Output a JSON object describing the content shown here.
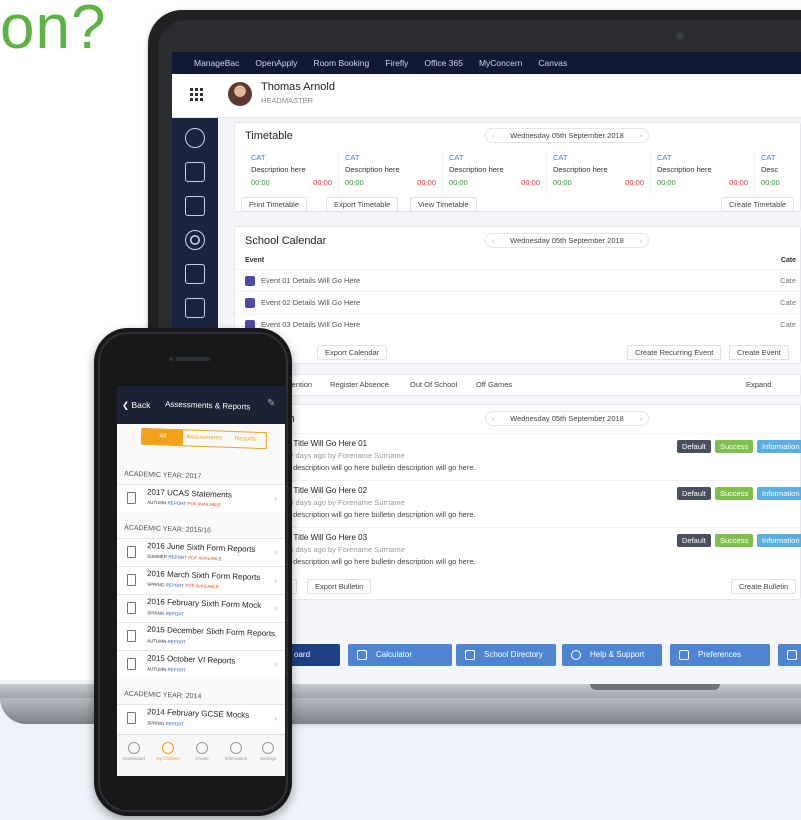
{
  "headline": "on?",
  "laptop": {
    "topnav": [
      "ManageBac",
      "OpenApply",
      "Room Booking",
      "Firefly",
      "Office 365",
      "MyConcern",
      "Canvas"
    ],
    "user": {
      "name": "Thomas Arnold",
      "role": "HEADMASTER"
    },
    "timetable": {
      "title": "Timetable",
      "date": "Wednesday 05th September 2018",
      "slots": [
        {
          "cat": "CAT",
          "desc": "Description here",
          "start": "00:00",
          "end": "00:00"
        },
        {
          "cat": "CAT",
          "desc": "Description here",
          "start": "00:00",
          "end": "00:00"
        },
        {
          "cat": "CAT",
          "desc": "Description here",
          "start": "00:00",
          "end": "00:00"
        },
        {
          "cat": "CAT",
          "desc": "Description here",
          "start": "00:00",
          "end": "00:00"
        },
        {
          "cat": "CAT",
          "desc": "Description here",
          "start": "00:00",
          "end": "00:00"
        },
        {
          "cat": "CAT",
          "desc": "Desc",
          "start": "00:00",
          "end": ""
        }
      ],
      "buttons": {
        "print": "Print Timetable",
        "export": "Export Timetable",
        "view": "View Timetable",
        "create": "Create Timetable"
      }
    },
    "calendar": {
      "title": "School Calendar",
      "date": "Wednesday 05th September 2018",
      "col_event": "Event",
      "col_cat": "Cate",
      "events": [
        {
          "text": "Event 01 Details Will Go Here",
          "cat": "Cate"
        },
        {
          "text": "Event 02 Details Will Go Here",
          "cat": "Cate"
        },
        {
          "text": "Event 03 Details Will Go Here",
          "cat": "Cate"
        }
      ],
      "buttons": {
        "view": "alendar",
        "export": "Export Calendar",
        "recurring": "Create Recurring Event",
        "create": "Create Event"
      }
    },
    "tabs": {
      "detention": "Detention",
      "absence": "Register Absence",
      "out": "Out Of School",
      "games": "Off Games",
      "expand": "Expand"
    },
    "bulletin": {
      "title": "tin",
      "date": "Wednesday 05th September 2018",
      "items": [
        {
          "title": "tin Title Will Go Here 01",
          "meta": "d 2 days ago by Forename Surname",
          "desc": "tin description will go here bulletin description will go here."
        },
        {
          "title": "tin Title Will Go Here 02",
          "meta": "d 3 days ago by Forename Surname",
          "desc": "tin description will go here bulletin description will go here."
        },
        {
          "title": "tin Title Will Go Here 03",
          "meta": "d 4 days ago by Forename Surname",
          "desc": "tin description will go here bulletin description will go here."
        }
      ],
      "tags": {
        "default": "Default",
        "success": "Success",
        "info": "Information"
      },
      "buttons": {
        "view": "tin",
        "export": "Export Bulletin",
        "create": "Create Bulletin"
      }
    },
    "quick": {
      "dashboard": "oard",
      "calculator": "Calculator",
      "directory": "School Directory",
      "help": "Help & Support",
      "prefs": "Preferences"
    }
  },
  "phone": {
    "back": "Back",
    "title": "Assessments & Reports",
    "segments": [
      "All",
      "Assessments",
      "Reports"
    ],
    "sections": [
      {
        "label": "ACADEMIC YEAR: 2017",
        "items": [
          {
            "title": "2017 UCAS Statements",
            "term": "AUTUMN",
            "type": "REPORT",
            "flag": "PDF AVAILABLE"
          }
        ]
      },
      {
        "label": "ACADEMIC YEAR: 2015/16",
        "items": [
          {
            "title": "2016 June Sixth Form Reports",
            "term": "SUMMER",
            "type": "REPORT",
            "flag": "PDF AVAILABLE"
          },
          {
            "title": "2016 March Sixth Form Reports",
            "term": "SPRING",
            "type": "REPORT",
            "flag": "PDF AVAILABLE"
          },
          {
            "title": "2016 February Sixth Form Mock",
            "term": "SPRING",
            "type": "REPORT",
            "flag": ""
          },
          {
            "title": "2015 December Sixth Form Reports",
            "term": "AUTUMN",
            "type": "REPORT",
            "flag": ""
          },
          {
            "title": "2015 October VI Reports",
            "term": "AUTUMN",
            "type": "REPORT",
            "flag": ""
          }
        ]
      },
      {
        "label": "ACADEMIC YEAR: 2014",
        "items": [
          {
            "title": "2014 February GCSE Mocks",
            "term": "SPRING",
            "type": "REPORT",
            "flag": ""
          }
        ]
      }
    ],
    "tabs": [
      "Dashboard",
      "My Children",
      "Create",
      "Information",
      "Settings"
    ]
  },
  "colors": {
    "accent": "#5cb245",
    "navy": "#0f1a34",
    "blue": "#4f85d0",
    "orange": "#f3a11a"
  }
}
